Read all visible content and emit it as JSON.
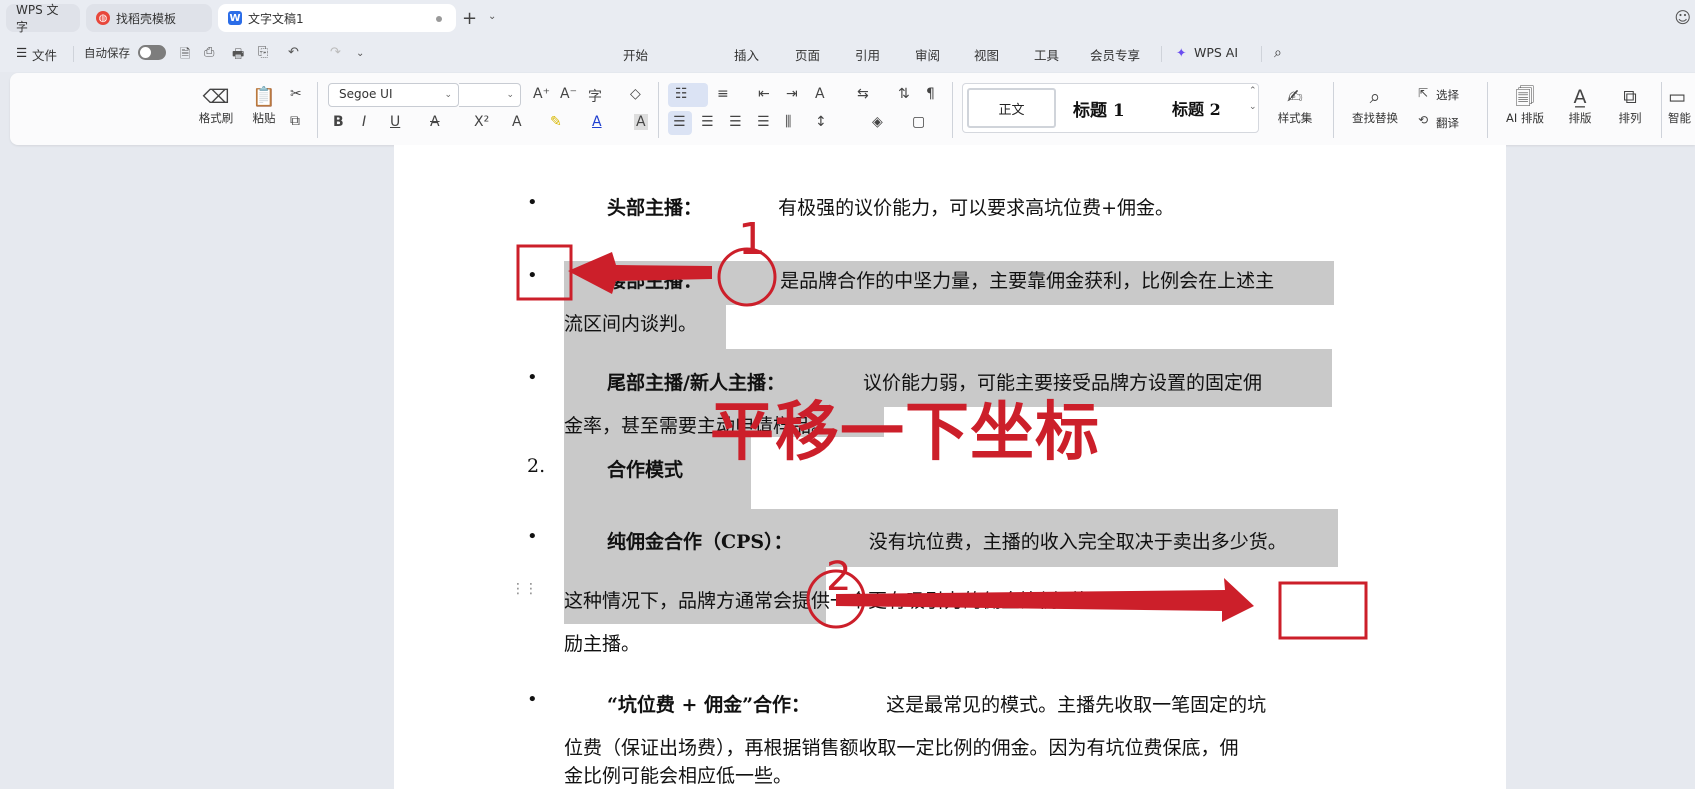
{
  "tabs": [
    {
      "label": "WPS 文字"
    },
    {
      "label": "找稻壳模板",
      "icon": "docer-icon"
    },
    {
      "label": "文字文稿1",
      "icon": "word-icon"
    }
  ],
  "menu": {
    "file": "文件",
    "autosave": "自动保存",
    "items": [
      "开始",
      "插入",
      "页面",
      "引用",
      "审阅",
      "视图",
      "工具",
      "会员专享"
    ],
    "ai": "WPS AI",
    "active": "开始"
  },
  "ribbon": {
    "format_painter": "格式刷",
    "paste": "粘贴",
    "font_name": "Segoe UI",
    "style_normal": "正文",
    "style_h1": "标题 1",
    "style_h2": "标题 2",
    "style_set": "样式集",
    "find_replace": "查找替换",
    "select": "选择",
    "translate": "翻译",
    "ai_layout": "AI 排版",
    "layout": "排版",
    "arrange": "排列",
    "smart": "智能"
  },
  "document": {
    "p1_label": "头部主播：",
    "p1_text": "有极强的议价能力，可以要求高坑位费+佣金。",
    "p2_label": "腰部主播：",
    "p2_text": "是品牌合作的中坚力量，主要靠佣金获利，比例会在上述主",
    "p2_cont": "流区间内谈判。",
    "p3_label": "尾部主播/新人主播：",
    "p3_text": "议价能力弱，可能主要接受品牌方设置的固定佣",
    "p3_cont": "金率，甚至需要主动申请样品。",
    "section_number": "2.",
    "section_title": "合作模式",
    "p4_label": "纯佣金合作（CPS）：",
    "p4_text": "没有坑位费，主播的收入完全取决于卖出多少货。",
    "p4_cont1": "这种情况下，品牌方通常会提供一个更有吸引力的佣金比例（如 30%以上）来激",
    "p4_cont2": "励主播。",
    "p5_label": "“坑位费 + 佣金”合作：",
    "p5_text": "这是最常见的模式。主播先收取一笔固定的坑",
    "p5_cont1": "位费（保证出场费），再根据销售额收取一定比例的佣金。因为有坑位费保底，佣",
    "p5_cont2": "金比例可能会相应低一些。"
  },
  "annotations": {
    "caption": "平移一下坐标",
    "marker1": "1",
    "marker2": "2",
    "color": "#cc1f2a"
  }
}
